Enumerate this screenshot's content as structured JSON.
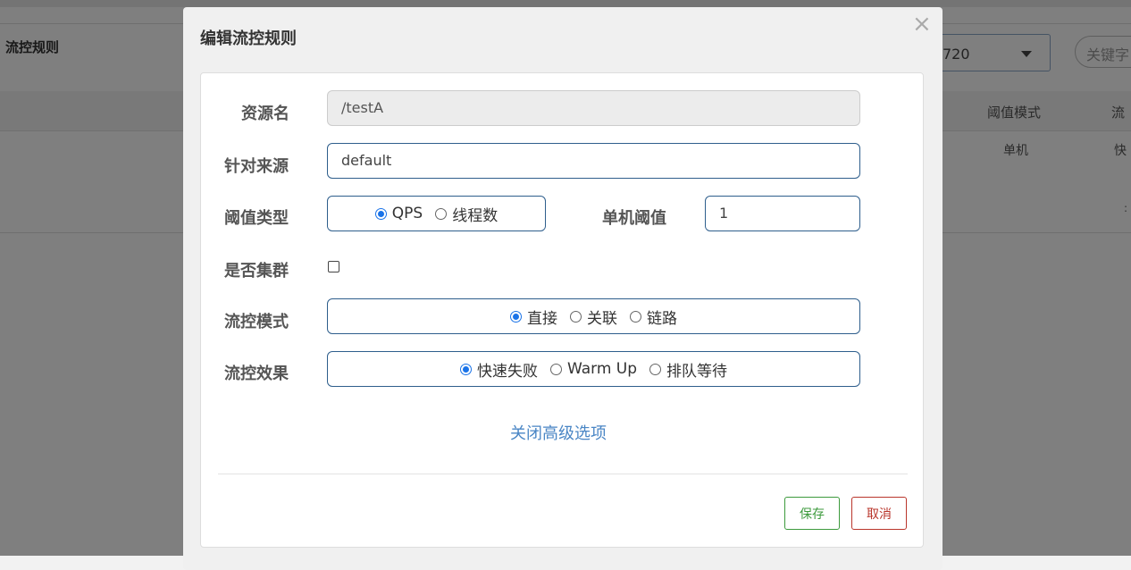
{
  "background": {
    "page_title": "流控规则",
    "machine_select_value": "720",
    "search_placeholder": "关键字",
    "table_headers": [
      "阈值模式",
      "流"
    ],
    "table_row": [
      "单机",
      "快"
    ]
  },
  "modal": {
    "title": "编辑流控规则",
    "close_icon": "×",
    "fields": {
      "resource_label": "资源名",
      "resource_value": "/testA",
      "limit_app_label": "针对来源",
      "limit_app_value": "default",
      "grade_label": "阈值类型",
      "grade_options": [
        "QPS",
        "线程数"
      ],
      "grade_selected": "QPS",
      "count_label": "单机阈值",
      "count_value": "1",
      "cluster_label": "是否集群",
      "cluster_checked": false,
      "strategy_label": "流控模式",
      "strategy_options": [
        "直接",
        "关联",
        "链路"
      ],
      "strategy_selected": "直接",
      "behavior_label": "流控效果",
      "behavior_options": [
        "快速失败",
        "Warm Up",
        "排队等待"
      ],
      "behavior_selected": "快速失败"
    },
    "advanced_link": "关闭高级选项",
    "save_button": "保存",
    "cancel_button": "取消"
  },
  "colors": {
    "accent_blue": "#1a73e8",
    "link_blue": "#4a86c5",
    "save_green": "#3c9a3c",
    "cancel_red": "#b9352b"
  }
}
